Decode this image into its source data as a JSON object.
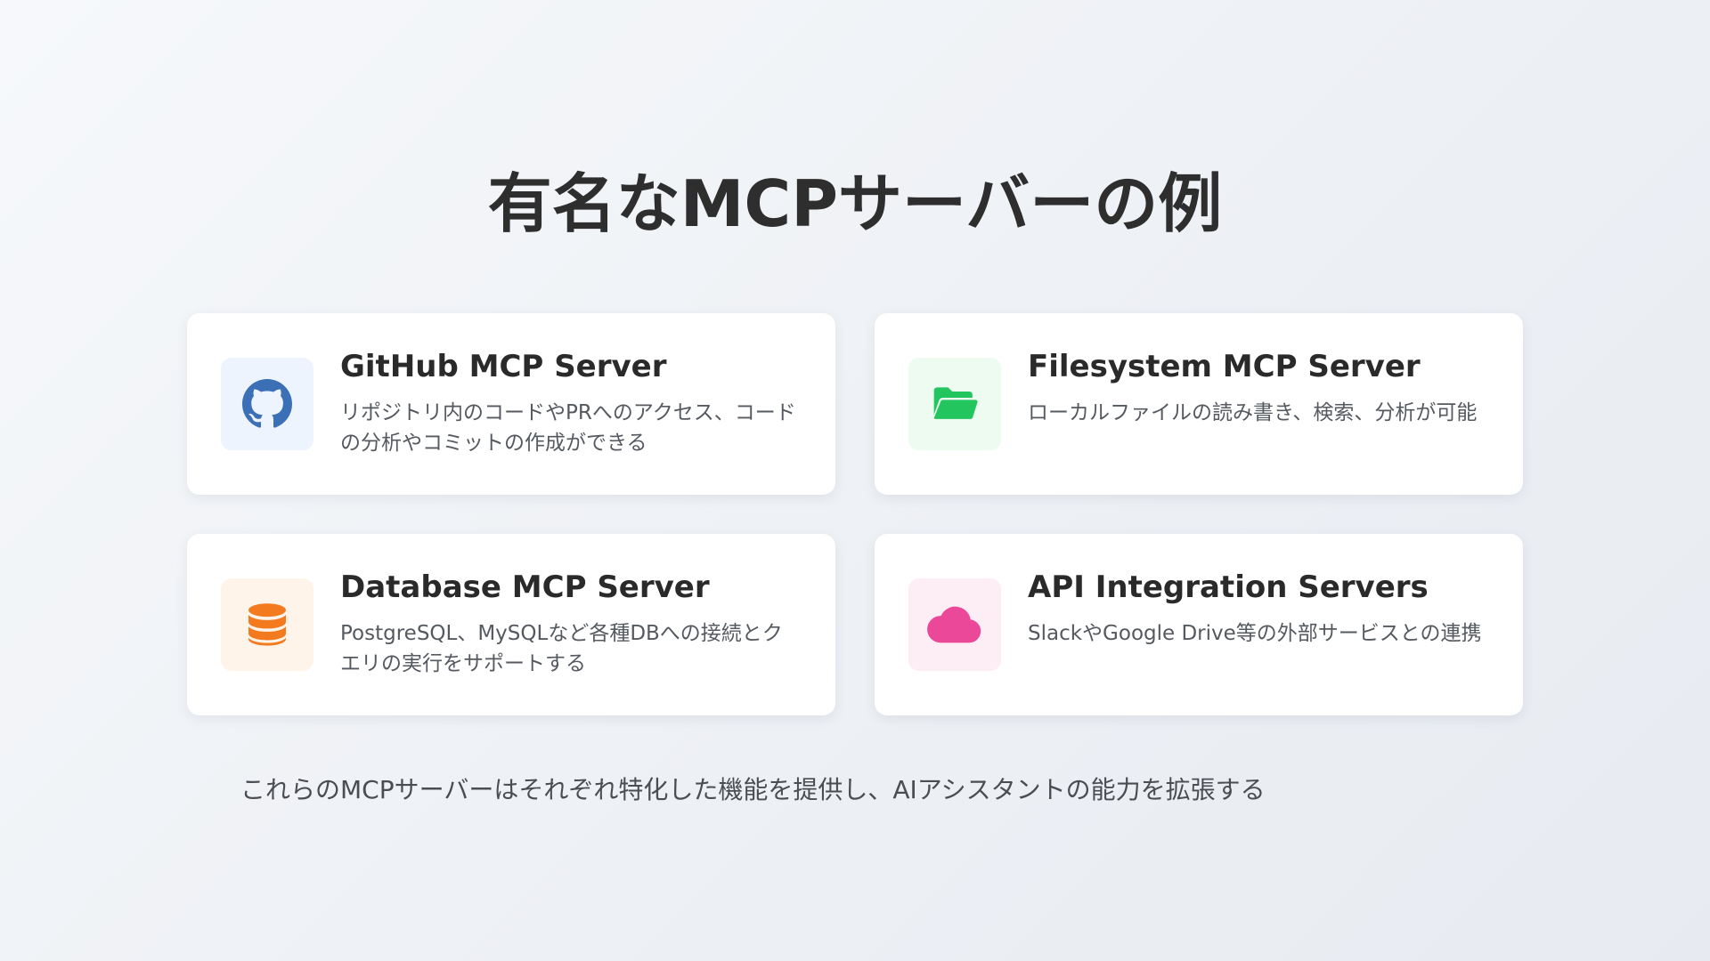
{
  "slide": {
    "title": "有名なMCPサーバーの例",
    "footer": "これらのMCPサーバーはそれぞれ特化した機能を提供し、AIアシスタントの能力を拡張する"
  },
  "cards": [
    {
      "title": "GitHub MCP Server",
      "description": "リポジトリ内のコードやPRへのアクセス、コードの分析やコミットの作成ができる",
      "icon": "github-icon",
      "icon_color": "#3b6fb6",
      "icon_bg": "#eef4fd"
    },
    {
      "title": "Filesystem MCP Server",
      "description": "ローカルファイルの読み書き、検索、分析が可能",
      "icon": "folder-open-icon",
      "icon_color": "#22c55e",
      "icon_bg": "#edfbf1"
    },
    {
      "title": "Database MCP Server",
      "description": "PostgreSQL、MySQLなど各種DBへの接続とクエリの実行をサポートする",
      "icon": "database-icon",
      "icon_color": "#f47a20",
      "icon_bg": "#fef4ea"
    },
    {
      "title": "API Integration Servers",
      "description": "SlackやGoogle Drive等の外部サービスとの連携",
      "icon": "cloud-icon",
      "icon_color": "#ec4899",
      "icon_bg": "#fdeef5"
    }
  ]
}
